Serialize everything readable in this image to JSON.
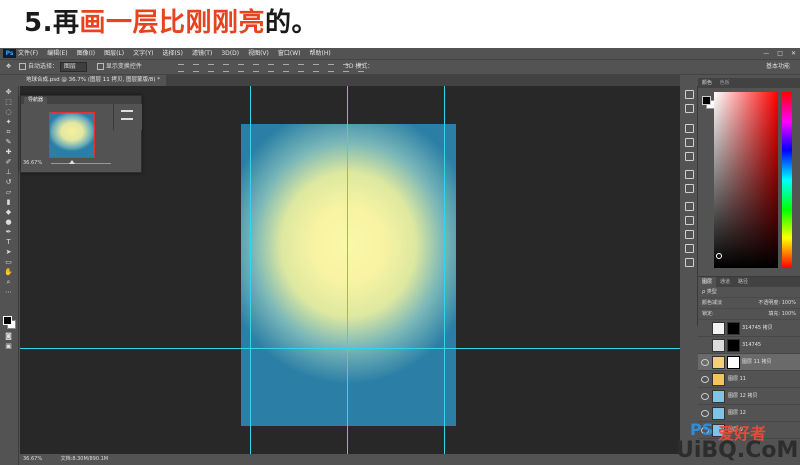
{
  "heading": {
    "prefix": "5.再",
    "highlight": "画一层比刚刚亮",
    "suffix": "的。"
  },
  "app": {
    "logo": "Ps",
    "menu": [
      "文件(F)",
      "编辑(E)",
      "图像(I)",
      "图层(L)",
      "文字(Y)",
      "选择(S)",
      "滤镜(T)",
      "3D(D)",
      "视图(V)",
      "窗口(W)",
      "帮助(H)"
    ],
    "window_controls": [
      "—",
      "□",
      "✕"
    ]
  },
  "options": {
    "auto_select_label": "自动选择：",
    "auto_select_value": "图层",
    "show_transform_label": "显示变换控件",
    "mode_label": "3D 模式：",
    "workspace": "基本功能"
  },
  "document": {
    "tab_title": "地球合成.psd @ 36.7% (图层 11 拷贝, 图层蒙版/8) *"
  },
  "navigator": {
    "tab": "导航器",
    "zoom": "36.67%"
  },
  "color": {
    "tab1": "颜色",
    "tab2": "色板",
    "fg": "#000000",
    "bg": "#ffffff"
  },
  "layers": {
    "tabs": [
      "图层",
      "通道",
      "路径"
    ],
    "filter_label": "ρ 类型",
    "blend_mode": "颜色减淡",
    "opacity_label": "不透明度:",
    "opacity": "100%",
    "lock_label": "锁定:",
    "fill_label": "填充:",
    "fill": "100%",
    "items": [
      {
        "name": "314745 拷贝",
        "thumb": "#f2f2f2",
        "mask": true
      },
      {
        "name": "314745",
        "thumb": "#dcdcdc",
        "mask": true
      },
      {
        "name": "图层 11 拷贝",
        "thumb": "#f3d07a",
        "mask": true,
        "selected": true
      },
      {
        "name": "图层 11",
        "thumb": "#f5c45e",
        "mask": false
      },
      {
        "name": "图层 12 拷贝",
        "thumb": "#7fc3e8",
        "mask": false
      },
      {
        "name": "图层 12",
        "thumb": "#7fc3e8",
        "mask": false
      },
      {
        "name": "图层 9",
        "thumb": "#7fc3e8",
        "mask": false
      }
    ]
  },
  "status": {
    "zoom": "36.67%",
    "doc": "文档:8.30M/890.1M"
  },
  "watermark": {
    "line1_a": "PS",
    "line1_b": "爱好者",
    "line2": "UiBQ.CoM"
  }
}
